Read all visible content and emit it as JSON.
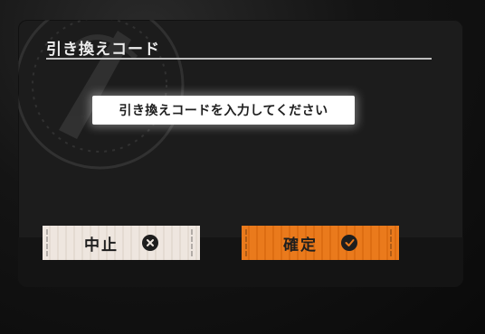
{
  "dialog": {
    "title": "引き換えコード",
    "input_placeholder": "引き換えコードを入力してください"
  },
  "buttons": {
    "cancel_label": "中止",
    "cancel_icon": "close-circle-icon",
    "confirm_label": "確定",
    "confirm_icon": "check-circle-icon"
  },
  "colors": {
    "confirm_accent": "#ea7a1c",
    "cancel_bg": "#eee6df",
    "dialog_bg": "#1c1c1c"
  }
}
